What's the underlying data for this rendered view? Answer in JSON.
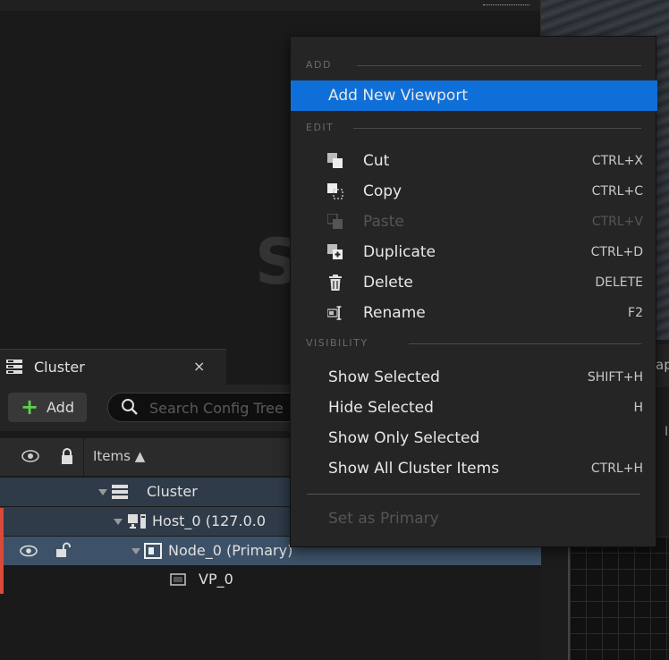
{
  "viewport": {
    "partial_letter": "S"
  },
  "right_panel": {
    "tab_text": "ap",
    "side_label": "I"
  },
  "cluster_panel": {
    "tab": {
      "label": "Cluster",
      "close_glyph": "×"
    },
    "toolbar": {
      "add_label": "Add",
      "add_glyph": "+",
      "search_placeholder": "Search Config Tree"
    },
    "header": {
      "items_label": "Items ▲"
    },
    "tree": [
      {
        "label": "Cluster",
        "icon": "cluster-icon"
      },
      {
        "label": "Host_0 (127.0.0",
        "icon": "host-icon"
      },
      {
        "label": "Node_0 (Primary)",
        "icon": "node-icon"
      },
      {
        "label": "VP_0",
        "icon": "viewport-icon"
      }
    ]
  },
  "context_menu": {
    "sections": {
      "add": "ADD",
      "edit": "EDIT",
      "visibility": "VISIBILITY"
    },
    "add_items": [
      {
        "label": "Add New Viewport",
        "shortcut": "",
        "highlighted": true
      }
    ],
    "edit_items": [
      {
        "label": "Cut",
        "shortcut": "CTRL+X",
        "icon": "cut-icon",
        "enabled": true
      },
      {
        "label": "Copy",
        "shortcut": "CTRL+C",
        "icon": "copy-icon",
        "enabled": true
      },
      {
        "label": "Paste",
        "shortcut": "CTRL+V",
        "icon": "paste-icon",
        "enabled": false
      },
      {
        "label": "Duplicate",
        "shortcut": "CTRL+D",
        "icon": "duplicate-icon",
        "enabled": true
      },
      {
        "label": "Delete",
        "shortcut": "DELETE",
        "icon": "trash-icon",
        "enabled": true
      },
      {
        "label": "Rename",
        "shortcut": "F2",
        "icon": "rename-icon",
        "enabled": true
      }
    ],
    "visibility_items": [
      {
        "label": "Show Selected",
        "shortcut": "SHIFT+H"
      },
      {
        "label": "Hide Selected",
        "shortcut": "H"
      },
      {
        "label": "Show Only Selected",
        "shortcut": ""
      },
      {
        "label": "Show All Cluster Items",
        "shortcut": "CTRL+H"
      }
    ],
    "footer_item": {
      "label": "Set as Primary",
      "enabled": false
    }
  },
  "colors": {
    "highlight": "#0f6fd8",
    "add_green": "#5bd14a",
    "selected_row": "#3d5268",
    "parent_row": "#2f3b49",
    "marker_red": "#d94a3a"
  }
}
